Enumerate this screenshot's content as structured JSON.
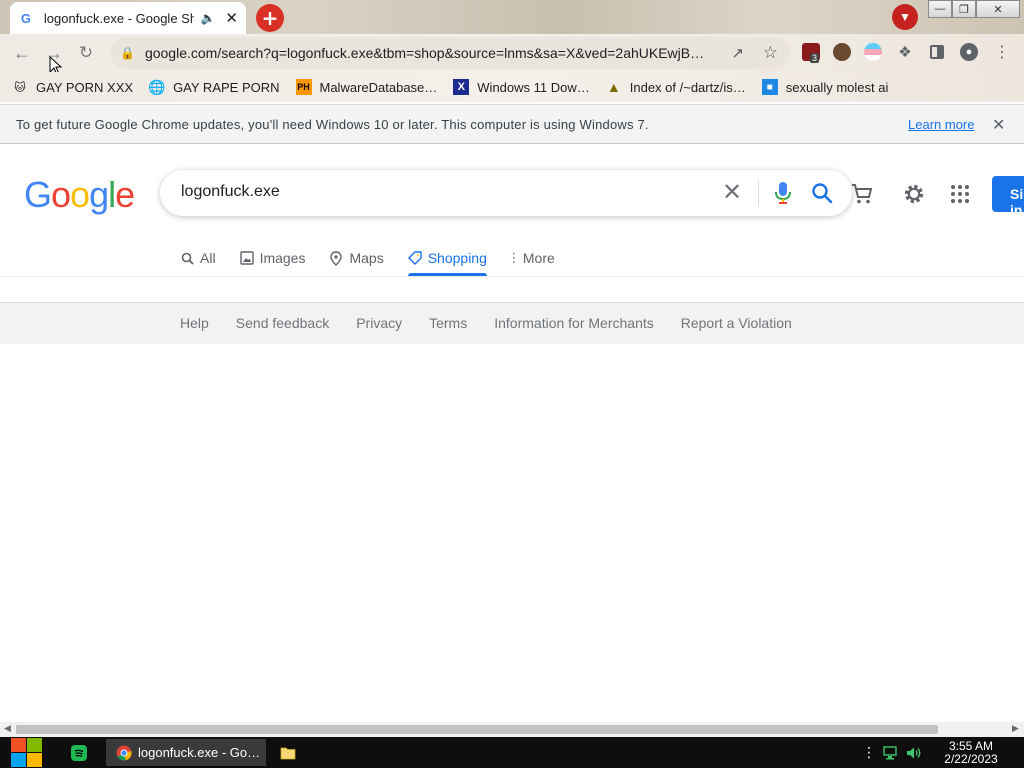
{
  "browser": {
    "tab_title": "logonfuck.exe - Google Shopping",
    "url": "google.com/search?q=logonfuck.exe&tbm=shop&source=lnms&sa=X&ved=2ahUKEwjB…",
    "extension_badge": "3"
  },
  "bookmarks": [
    {
      "label": "GAY PORN XXX"
    },
    {
      "label": "GAY RAPE PORN"
    },
    {
      "label": "MalwareDatabase…",
      "icon_text": "PH"
    },
    {
      "label": "Windows 11 Dow…",
      "icon_text": "X"
    },
    {
      "label": "Index of /~dartz/is…"
    },
    {
      "label": "sexually molest ai"
    }
  ],
  "infobar": {
    "message": "To get future Google Chrome updates, you'll need Windows 10 or later. This computer is using Windows 7.",
    "link": "Learn more"
  },
  "google": {
    "logo": [
      "G",
      "o",
      "o",
      "g",
      "l",
      "e"
    ],
    "query": "logonfuck.exe",
    "signin": "Sign in",
    "tabs": [
      {
        "label": "All"
      },
      {
        "label": "Images"
      },
      {
        "label": "Maps"
      },
      {
        "label": "Shopping",
        "active": true
      },
      {
        "label": "More"
      }
    ],
    "footer_links": [
      "Help",
      "Send feedback",
      "Privacy",
      "Terms",
      "Information for Merchants",
      "Report a Violation"
    ]
  },
  "taskbar": {
    "chrome_label": "logonfuck.exe - Go…",
    "time": "3:55 AM",
    "date": "2/22/2023"
  },
  "colors": {
    "accent": "#1a73e8",
    "google_blue": "#4285f4",
    "google_red": "#ea4335",
    "google_yellow": "#fbbc05",
    "google_green": "#34a853"
  }
}
